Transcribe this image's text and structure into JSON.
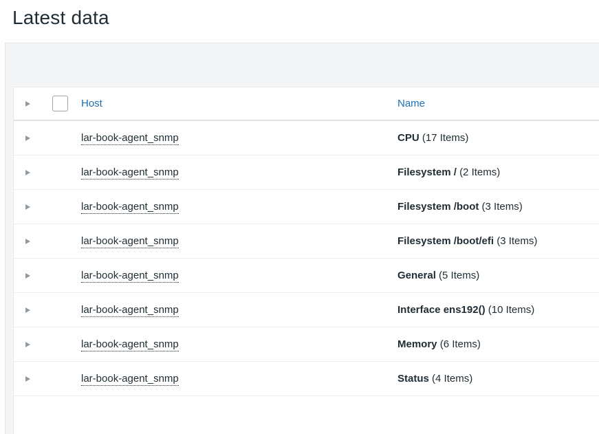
{
  "page": {
    "title": "Latest data"
  },
  "table": {
    "columns": {
      "host": "Host",
      "name": "Name"
    },
    "rows": [
      {
        "host": "lar-book-agent_snmp",
        "app": "CPU",
        "count": "(17 Items)"
      },
      {
        "host": "lar-book-agent_snmp",
        "app": "Filesystem /",
        "count": "(2 Items)"
      },
      {
        "host": "lar-book-agent_snmp",
        "app": "Filesystem /boot",
        "count": "(3 Items)"
      },
      {
        "host": "lar-book-agent_snmp",
        "app": "Filesystem /boot/efi",
        "count": "(3 Items)"
      },
      {
        "host": "lar-book-agent_snmp",
        "app": "General",
        "count": "(5 Items)"
      },
      {
        "host": "lar-book-agent_snmp",
        "app": "Interface ens192()",
        "count": "(10 Items)"
      },
      {
        "host": "lar-book-agent_snmp",
        "app": "Memory",
        "count": "(6 Items)"
      },
      {
        "host": "lar-book-agent_snmp",
        "app": "Status",
        "count": "(4 Items)"
      }
    ]
  },
  "icons": {
    "expand": "triangle-right-icon"
  },
  "colors": {
    "link": "#1b6fb3",
    "text": "#1f2c33",
    "band": "#f4f5f6"
  }
}
